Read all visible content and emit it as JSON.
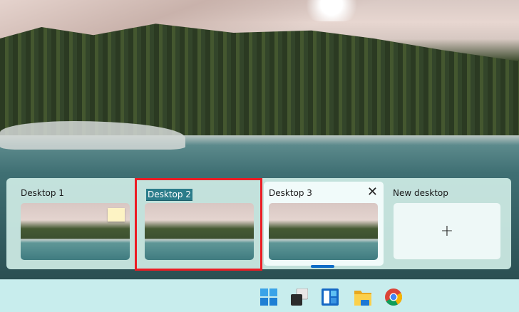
{
  "desktops": [
    {
      "label": "Desktop 1"
    },
    {
      "label": "Desktop 2",
      "editing": true
    },
    {
      "label": "Desktop 3",
      "close_icon": "close-icon",
      "active": true
    },
    {
      "label": "New desktop",
      "icon": "plus-icon",
      "plus": "+"
    }
  ],
  "taskbar": {
    "icons": [
      "windows-start-icon",
      "task-view-icon",
      "widgets-icon",
      "file-explorer-icon",
      "chrome-icon"
    ]
  },
  "colors": {
    "highlight": "#ec1c24",
    "accent": "#0e6cc6"
  }
}
